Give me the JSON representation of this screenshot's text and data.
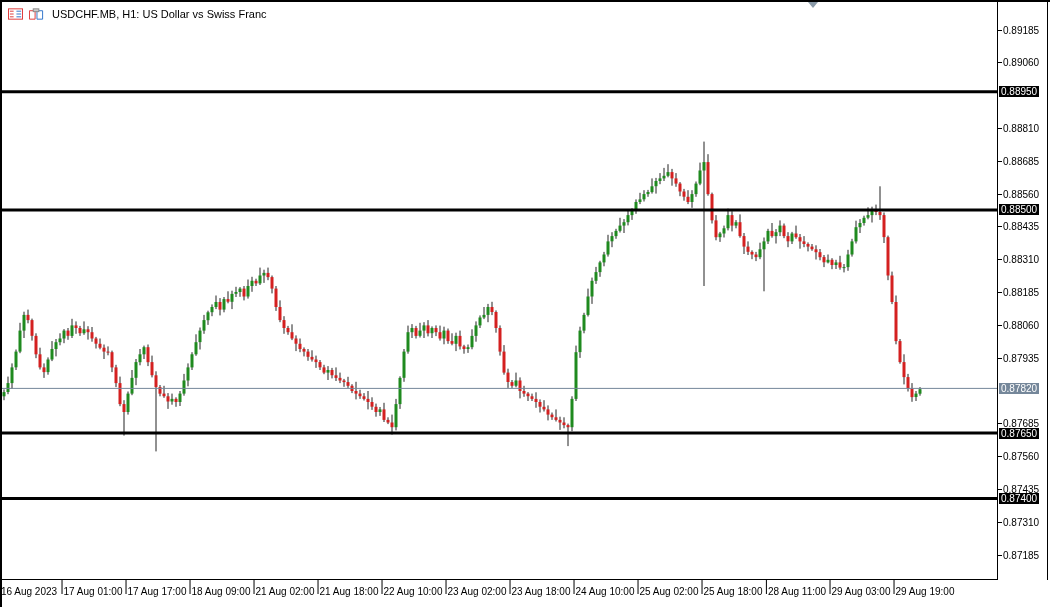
{
  "window": {
    "title": "USDCHF.MB, H1:  US Dollar vs Swiss Franc"
  },
  "chart": {
    "chart_data": {
      "type": "candlestick",
      "ylim": [
        0.8709,
        0.89292
      ],
      "ref_lines": [
        {
          "axis": "y",
          "value": 0.8895,
          "label": "0.88950",
          "color": "#000000"
        },
        {
          "axis": "y",
          "value": 0.885,
          "label": "0.88500",
          "color": "#000000"
        },
        {
          "axis": "y",
          "value": 0.8782,
          "label": "0.87820",
          "color": "#75879a"
        },
        {
          "axis": "y",
          "value": 0.8765,
          "label": "0.87650",
          "color": "#000000"
        },
        {
          "axis": "y",
          "value": 0.874,
          "label": "0.87400",
          "color": "#000000"
        }
      ],
      "categories": [
        null,
        null,
        null,
        null,
        null,
        null,
        "16 Aug 2023",
        null,
        null,
        null,
        null,
        null,
        null,
        null,
        null,
        null,
        null,
        null,
        null,
        null,
        null,
        null,
        "17 Aug 01:00",
        null,
        null,
        null,
        null,
        null,
        null,
        null,
        null,
        null,
        null,
        null,
        null,
        null,
        null,
        null,
        "17 Aug 17:00",
        null,
        null,
        null,
        null,
        null,
        null,
        null,
        null,
        null,
        null,
        null,
        null,
        null,
        null,
        null,
        "18 Aug 09:00",
        null,
        null,
        null,
        null,
        null,
        null,
        null,
        null,
        null,
        null,
        null,
        null,
        null,
        null,
        null,
        "21 Aug 02:00",
        null,
        null,
        null,
        null,
        null,
        null,
        null,
        null,
        null,
        null,
        null,
        null,
        null,
        null,
        null,
        "21 Aug 18:00",
        null,
        null,
        null,
        null,
        null,
        null,
        null,
        null,
        null,
        null,
        null,
        null,
        null,
        null,
        null,
        "22 Aug 10:00",
        null,
        null,
        null,
        null,
        null,
        null,
        null,
        null,
        null,
        null,
        null,
        null,
        null,
        null,
        null,
        "23 Aug 02:00",
        null,
        null,
        null,
        null,
        null,
        null,
        null,
        null,
        null,
        null,
        null,
        null,
        null,
        null,
        null,
        "23 Aug 18:00",
        null,
        null,
        null,
        null,
        null,
        null,
        null,
        null,
        null,
        null,
        null,
        null,
        null,
        null,
        null,
        "24 Aug 10:00",
        null,
        null,
        null,
        null,
        null,
        null,
        null,
        null,
        null,
        null,
        null,
        null,
        null,
        null,
        null,
        "25 Aug 02:00",
        null,
        null,
        null,
        null,
        null,
        null,
        null,
        null,
        null,
        null,
        null,
        null,
        null,
        null,
        null,
        "25 Aug 18:00",
        null,
        null,
        null,
        null,
        null,
        null,
        null,
        null,
        null,
        null,
        null,
        null,
        null,
        null,
        null,
        "28 Aug 11:00",
        null,
        null,
        null,
        null,
        null,
        null,
        null,
        null,
        null,
        null,
        null,
        null,
        null,
        null,
        null,
        "29 Aug 03:00",
        null,
        null,
        null,
        null,
        null,
        null,
        null,
        null,
        null,
        null,
        null,
        null,
        null,
        null,
        null,
        "29 Aug 19:00",
        null,
        null,
        null,
        null,
        null,
        null,
        null,
        null,
        null,
        null,
        null,
        null,
        null,
        null,
        null,
        null,
        null,
        null
      ],
      "ohlc": [
        [
          0.8779,
          0.87816,
          0.87775,
          0.87806
        ],
        [
          0.87806,
          0.87865,
          0.87798,
          0.8784
        ],
        [
          0.8784,
          0.87915,
          0.87818,
          0.879
        ],
        [
          0.879,
          0.87968,
          0.8789,
          0.8796
        ],
        [
          0.8796,
          0.8807,
          0.87954,
          0.8804
        ],
        [
          0.8804,
          0.88112,
          0.88012,
          0.881
        ],
        [
          0.881,
          0.8812,
          0.88068,
          0.8808
        ],
        [
          0.8808,
          0.88086,
          0.88002,
          0.8802
        ],
        [
          0.8802,
          0.8803,
          0.87935,
          0.8795
        ],
        [
          0.8795,
          0.87975,
          0.87892,
          0.879
        ],
        [
          0.879,
          0.87915,
          0.8786,
          0.87882
        ],
        [
          0.87882,
          0.87938,
          0.87872,
          0.8793
        ],
        [
          0.8793,
          0.88,
          0.87924,
          0.8797
        ],
        [
          0.8797,
          0.88008,
          0.87942,
          0.87996
        ],
        [
          0.87996,
          0.8803,
          0.87984,
          0.8801
        ],
        [
          0.8801,
          0.88046,
          0.87992,
          0.8804
        ],
        [
          0.8804,
          0.8805,
          0.88005,
          0.8802
        ],
        [
          0.8802,
          0.88085,
          0.88012,
          0.8806
        ],
        [
          0.8806,
          0.88075,
          0.88028,
          0.8805
        ],
        [
          0.8805,
          0.88058,
          0.8802,
          0.8803
        ],
        [
          0.8803,
          0.88075,
          0.88024,
          0.88045
        ],
        [
          0.88045,
          0.88057,
          0.88006,
          0.88034
        ],
        [
          0.88034,
          0.88054,
          0.87998,
          0.8801
        ],
        [
          0.8801,
          0.88016,
          0.87972,
          0.8799
        ],
        [
          0.8799,
          0.8801,
          0.87969,
          0.87975
        ],
        [
          0.87975,
          0.87987,
          0.87932,
          0.8796
        ],
        [
          0.8796,
          0.8798,
          0.87946,
          0.87958
        ],
        [
          0.87958,
          0.87964,
          0.87882,
          0.879
        ],
        [
          0.879,
          0.8791,
          0.87825,
          0.8784
        ],
        [
          0.8784,
          0.87865,
          0.87752,
          0.8776
        ],
        [
          0.8776,
          0.87775,
          0.8764,
          0.8773
        ],
        [
          0.8773,
          0.87808,
          0.8772,
          0.878
        ],
        [
          0.878,
          0.8789,
          0.87794,
          0.8786
        ],
        [
          0.8786,
          0.87932,
          0.87832,
          0.8792
        ],
        [
          0.8792,
          0.8797,
          0.87908,
          0.8795
        ],
        [
          0.8795,
          0.87983,
          0.87932,
          0.87977
        ],
        [
          0.87977,
          0.87987,
          0.87905,
          0.8792
        ],
        [
          0.8792,
          0.87945,
          0.87862,
          0.8787
        ],
        [
          0.8787,
          0.87885,
          0.8758,
          0.87825
        ],
        [
          0.87825,
          0.87833,
          0.8779,
          0.878
        ],
        [
          0.878,
          0.8783,
          0.87784,
          0.8779
        ],
        [
          0.8779,
          0.87802,
          0.87742,
          0.8777
        ],
        [
          0.8777,
          0.878,
          0.87758,
          0.8778
        ],
        [
          0.8778,
          0.87786,
          0.8775,
          0.87768
        ],
        [
          0.87768,
          0.8781,
          0.87753,
          0.878
        ],
        [
          0.878,
          0.87875,
          0.87792,
          0.8785
        ],
        [
          0.8785,
          0.87915,
          0.87828,
          0.879
        ],
        [
          0.879,
          0.87958,
          0.8789,
          0.8795
        ],
        [
          0.8795,
          0.88026,
          0.87944,
          0.87996
        ],
        [
          0.87996,
          0.88052,
          0.87968,
          0.8804
        ],
        [
          0.8804,
          0.881,
          0.88028,
          0.8808
        ],
        [
          0.8808,
          0.88116,
          0.88062,
          0.8811
        ],
        [
          0.8811,
          0.8814,
          0.88095,
          0.8813
        ],
        [
          0.8813,
          0.88174,
          0.88122,
          0.88149
        ],
        [
          0.88149,
          0.88164,
          0.88098,
          0.8812
        ],
        [
          0.8812,
          0.88168,
          0.8811,
          0.8816
        ],
        [
          0.8816,
          0.8819,
          0.88144,
          0.8815
        ],
        [
          0.8815,
          0.88192,
          0.88122,
          0.8818
        ],
        [
          0.8818,
          0.88207,
          0.88168,
          0.88187
        ],
        [
          0.88187,
          0.88206,
          0.88169,
          0.882
        ],
        [
          0.882,
          0.8821,
          0.88155,
          0.8817
        ],
        [
          0.8817,
          0.88235,
          0.88162,
          0.8821
        ],
        [
          0.8821,
          0.88245,
          0.88188,
          0.8823
        ],
        [
          0.8823,
          0.88238,
          0.8821,
          0.8822
        ],
        [
          0.8822,
          0.8828,
          0.88214,
          0.8825
        ],
        [
          0.8825,
          0.88272,
          0.88222,
          0.8826
        ],
        [
          0.8826,
          0.8828,
          0.88232,
          0.88244
        ],
        [
          0.88244,
          0.8825,
          0.88182,
          0.882
        ],
        [
          0.882,
          0.8821,
          0.88115,
          0.8813
        ],
        [
          0.8813,
          0.88155,
          0.88072,
          0.8808
        ],
        [
          0.8808,
          0.88095,
          0.88028,
          0.8805
        ],
        [
          0.8805,
          0.88058,
          0.88024,
          0.88034
        ],
        [
          0.88034,
          0.88064,
          0.88004,
          0.8801
        ],
        [
          0.8801,
          0.88022,
          0.87962,
          0.8799
        ],
        [
          0.8799,
          0.8801,
          0.87958,
          0.8797
        ],
        [
          0.8797,
          0.87976,
          0.87942,
          0.8796
        ],
        [
          0.8796,
          0.8797,
          0.87925,
          0.8794
        ],
        [
          0.8794,
          0.87965,
          0.87922,
          0.8793
        ],
        [
          0.8793,
          0.87945,
          0.87898,
          0.8792
        ],
        [
          0.8792,
          0.87928,
          0.8789,
          0.879
        ],
        [
          0.879,
          0.8791,
          0.87874,
          0.8788
        ],
        [
          0.8788,
          0.87905,
          0.87852,
          0.8789
        ],
        [
          0.8789,
          0.87898,
          0.87858,
          0.8787
        ],
        [
          0.8787,
          0.879,
          0.87848,
          0.8786
        ],
        [
          0.8786,
          0.8788,
          0.8784,
          0.8785
        ],
        [
          0.8785,
          0.87856,
          0.87826,
          0.87844
        ],
        [
          0.87844,
          0.87864,
          0.87822,
          0.8783
        ],
        [
          0.8783,
          0.87836,
          0.87802,
          0.8781
        ],
        [
          0.8781,
          0.87845,
          0.87778,
          0.878
        ],
        [
          0.878,
          0.87815,
          0.8778,
          0.8779
        ],
        [
          0.8779,
          0.87802,
          0.87774,
          0.8778
        ],
        [
          0.8778,
          0.8781,
          0.8774,
          0.87768
        ],
        [
          0.87768,
          0.87786,
          0.87738,
          0.8775
        ],
        [
          0.8775,
          0.87762,
          0.87712,
          0.8773
        ],
        [
          0.8773,
          0.87749,
          0.87715,
          0.8774
        ],
        [
          0.8774,
          0.87765,
          0.87692,
          0.877
        ],
        [
          0.877,
          0.8771,
          0.87684,
          0.8769
        ],
        [
          0.8769,
          0.8772,
          0.87644,
          0.87672
        ],
        [
          0.87672,
          0.8778,
          0.8766,
          0.8776
        ],
        [
          0.8776,
          0.87866,
          0.87742,
          0.8786
        ],
        [
          0.8786,
          0.8797,
          0.87845,
          0.8796
        ],
        [
          0.8796,
          0.88059,
          0.87952,
          0.88034
        ],
        [
          0.88034,
          0.88065,
          0.88012,
          0.8805
        ],
        [
          0.8805,
          0.88058,
          0.8801,
          0.8802
        ],
        [
          0.8802,
          0.8807,
          0.88014,
          0.8804
        ],
        [
          0.8804,
          0.88072,
          0.88012,
          0.8806
        ],
        [
          0.8806,
          0.8808,
          0.88018,
          0.8803
        ],
        [
          0.8803,
          0.88056,
          0.88012,
          0.8805
        ],
        [
          0.8805,
          0.8806,
          0.88019,
          0.88034
        ],
        [
          0.88034,
          0.88059,
          0.88002,
          0.8801
        ],
        [
          0.8801,
          0.88055,
          0.87988,
          0.8804
        ],
        [
          0.8804,
          0.88048,
          0.8799,
          0.88
        ],
        [
          0.88,
          0.8803,
          0.87984,
          0.8799
        ],
        [
          0.8799,
          0.88032,
          0.87962,
          0.8802
        ],
        [
          0.8802,
          0.8804,
          0.87968,
          0.8798
        ],
        [
          0.8798,
          0.87986,
          0.87952,
          0.8797
        ],
        [
          0.8797,
          0.87987,
          0.87955,
          0.87977
        ],
        [
          0.87977,
          0.88045,
          0.87969,
          0.8802
        ],
        [
          0.8802,
          0.88075,
          0.87998,
          0.8806
        ],
        [
          0.8806,
          0.88098,
          0.8805,
          0.8809
        ],
        [
          0.8809,
          0.8813,
          0.88084,
          0.881
        ],
        [
          0.881,
          0.88142,
          0.88072,
          0.8813
        ],
        [
          0.8813,
          0.8815,
          0.88099,
          0.88111
        ],
        [
          0.88111,
          0.88117,
          0.88032,
          0.8805
        ],
        [
          0.8805,
          0.8806,
          0.87945,
          0.8796
        ],
        [
          0.8796,
          0.87985,
          0.87872,
          0.8788
        ],
        [
          0.8788,
          0.87895,
          0.87822,
          0.87844
        ],
        [
          0.87844,
          0.87852,
          0.87822,
          0.8783
        ],
        [
          0.8783,
          0.8788,
          0.87824,
          0.8785
        ],
        [
          0.8785,
          0.87862,
          0.87782,
          0.8781
        ],
        [
          0.8781,
          0.8783,
          0.87788,
          0.878
        ],
        [
          0.878,
          0.87806,
          0.87772,
          0.8779
        ],
        [
          0.8779,
          0.878,
          0.87772,
          0.8778
        ],
        [
          0.8778,
          0.87805,
          0.87746,
          0.87768
        ],
        [
          0.87768,
          0.87778,
          0.87728,
          0.8775
        ],
        [
          0.8775,
          0.87775,
          0.87732,
          0.8774
        ],
        [
          0.8774,
          0.87755,
          0.87698,
          0.8772
        ],
        [
          0.8772,
          0.87728,
          0.877,
          0.8771
        ],
        [
          0.8771,
          0.8774,
          0.87694,
          0.877
        ],
        [
          0.877,
          0.87712,
          0.87662,
          0.8769
        ],
        [
          0.8769,
          0.8771,
          0.87668,
          0.8768
        ],
        [
          0.8768,
          0.87686,
          0.876,
          0.87672
        ],
        [
          0.87672,
          0.8779,
          0.87657,
          0.8778
        ],
        [
          0.8778,
          0.87983,
          0.87772,
          0.87958
        ],
        [
          0.87958,
          0.88055,
          0.87936,
          0.8804
        ],
        [
          0.8804,
          0.88108,
          0.8803,
          0.881
        ],
        [
          0.881,
          0.882,
          0.88094,
          0.8817
        ],
        [
          0.8817,
          0.88242,
          0.88142,
          0.8823
        ],
        [
          0.8823,
          0.88283,
          0.88218,
          0.88263
        ],
        [
          0.88263,
          0.88306,
          0.88245,
          0.883
        ],
        [
          0.883,
          0.8834,
          0.88285,
          0.8833
        ],
        [
          0.8833,
          0.88405,
          0.88322,
          0.8838
        ],
        [
          0.8838,
          0.88415,
          0.88358,
          0.884
        ],
        [
          0.884,
          0.88428,
          0.8839,
          0.8842
        ],
        [
          0.8842,
          0.8847,
          0.88414,
          0.8844
        ],
        [
          0.8844,
          0.88465,
          0.88412,
          0.88453
        ],
        [
          0.88453,
          0.885,
          0.88441,
          0.8848
        ],
        [
          0.8848,
          0.88506,
          0.88462,
          0.885
        ],
        [
          0.885,
          0.8854,
          0.88485,
          0.8853
        ],
        [
          0.8853,
          0.88565,
          0.88522,
          0.8854
        ],
        [
          0.8854,
          0.88575,
          0.88532,
          0.8856
        ],
        [
          0.8856,
          0.88576,
          0.8855,
          0.88568
        ],
        [
          0.88568,
          0.8862,
          0.88562,
          0.8859
        ],
        [
          0.8859,
          0.88622,
          0.88562,
          0.8861
        ],
        [
          0.8861,
          0.8864,
          0.88598,
          0.8862
        ],
        [
          0.8862,
          0.8866,
          0.8861,
          0.8863
        ],
        [
          0.8863,
          0.88674,
          0.88624,
          0.88644
        ],
        [
          0.88644,
          0.88656,
          0.88592,
          0.8862
        ],
        [
          0.8862,
          0.8864,
          0.88588,
          0.886
        ],
        [
          0.886,
          0.88606,
          0.88552,
          0.8857
        ],
        [
          0.8857,
          0.8858,
          0.88535,
          0.8855
        ],
        [
          0.8855,
          0.88575,
          0.88522,
          0.8853
        ],
        [
          0.8853,
          0.88575,
          0.88508,
          0.8856
        ],
        [
          0.8856,
          0.88608,
          0.8855,
          0.886
        ],
        [
          0.886,
          0.8868,
          0.88594,
          0.8865
        ],
        [
          0.8865,
          0.8876,
          0.8821,
          0.88682
        ],
        [
          0.88682,
          0.88712,
          0.88554,
          0.8856
        ],
        [
          0.8856,
          0.88566,
          0.88448,
          0.8846
        ],
        [
          0.8846,
          0.8848,
          0.88384,
          0.88396
        ],
        [
          0.88396,
          0.88416,
          0.88378,
          0.8841
        ],
        [
          0.8841,
          0.8844,
          0.88395,
          0.8843
        ],
        [
          0.8843,
          0.88505,
          0.88422,
          0.8848
        ],
        [
          0.8848,
          0.88495,
          0.88418,
          0.8844
        ],
        [
          0.8844,
          0.88461,
          0.8843,
          0.88453
        ],
        [
          0.88453,
          0.88483,
          0.88394,
          0.884
        ],
        [
          0.884,
          0.88412,
          0.88332,
          0.8836
        ],
        [
          0.8836,
          0.8838,
          0.88328,
          0.8834
        ],
        [
          0.8834,
          0.88346,
          0.88312,
          0.8833
        ],
        [
          0.8833,
          0.8834,
          0.88305,
          0.8832
        ],
        [
          0.8832,
          0.88375,
          0.88312,
          0.8835
        ],
        [
          0.8835,
          0.88395,
          0.8819,
          0.8838
        ],
        [
          0.8838,
          0.88428,
          0.8837,
          0.8842
        ],
        [
          0.8842,
          0.8845,
          0.88394,
          0.884
        ],
        [
          0.884,
          0.88427,
          0.88372,
          0.88415
        ],
        [
          0.88415,
          0.8846,
          0.884,
          0.8844
        ],
        [
          0.8844,
          0.88448,
          0.88392,
          0.884
        ],
        [
          0.884,
          0.88415,
          0.88358,
          0.8838
        ],
        [
          0.8838,
          0.88416,
          0.8837,
          0.8841
        ],
        [
          0.8841,
          0.8844,
          0.8839,
          0.88396
        ],
        [
          0.88396,
          0.88408,
          0.88352,
          0.8838
        ],
        [
          0.8838,
          0.884,
          0.88358,
          0.8837
        ],
        [
          0.8837,
          0.88376,
          0.88342,
          0.8836
        ],
        [
          0.8836,
          0.8837,
          0.88344,
          0.8835
        ],
        [
          0.8835,
          0.88365,
          0.88311,
          0.88339
        ],
        [
          0.88339,
          0.88351,
          0.88308,
          0.8832
        ],
        [
          0.8832,
          0.88328,
          0.88282,
          0.883
        ],
        [
          0.883,
          0.8833,
          0.88296,
          0.8831
        ],
        [
          0.8831,
          0.88316,
          0.88274,
          0.8829
        ],
        [
          0.8829,
          0.8831,
          0.88275,
          0.883
        ],
        [
          0.883,
          0.88325,
          0.88272,
          0.8828
        ],
        [
          0.8828,
          0.88294,
          0.88262,
          0.88282
        ],
        [
          0.88282,
          0.88348,
          0.88268,
          0.8833
        ],
        [
          0.8833,
          0.8839,
          0.88322,
          0.8838
        ],
        [
          0.8838,
          0.88459,
          0.88372,
          0.88434
        ],
        [
          0.88434,
          0.88465,
          0.88412,
          0.8845
        ],
        [
          0.8845,
          0.88478,
          0.8844,
          0.8847
        ],
        [
          0.8847,
          0.8851,
          0.88464,
          0.8848
        ],
        [
          0.8848,
          0.88512,
          0.88452,
          0.885
        ],
        [
          0.885,
          0.8852,
          0.8848,
          0.88492
        ],
        [
          0.88492,
          0.8859,
          0.88462,
          0.8848
        ],
        [
          0.8848,
          0.8849,
          0.88374,
          0.88396
        ],
        [
          0.88396,
          0.88402,
          0.88232,
          0.8825
        ],
        [
          0.8825,
          0.88265,
          0.88141,
          0.88149
        ],
        [
          0.88149,
          0.88174,
          0.87988,
          0.88
        ],
        [
          0.88,
          0.88008,
          0.87914,
          0.8792
        ],
        [
          0.8792,
          0.8795,
          0.87835,
          0.87863
        ],
        [
          0.87863,
          0.87875,
          0.87808,
          0.8782
        ],
        [
          0.8782,
          0.8784,
          0.87769,
          0.87787
        ],
        [
          0.87787,
          0.8781,
          0.87772,
          0.878
        ],
        [
          0.878,
          0.87825,
          0.87792,
          0.87817
        ],
        null,
        null,
        null,
        null,
        null,
        null,
        null,
        null,
        null,
        null,
        null,
        null,
        null,
        null,
        null,
        null,
        null,
        null,
        null
      ],
      "yticks": [
        {
          "value": 0.89185,
          "label": "0.89185"
        },
        {
          "value": 0.8906,
          "label": "0.89060"
        },
        {
          "value": 0.8881,
          "label": "0.88810"
        },
        {
          "value": 0.88685,
          "label": "0.88685"
        },
        {
          "value": 0.8856,
          "label": "0.88560"
        },
        {
          "value": 0.88435,
          "label": "0.88435"
        },
        {
          "value": 0.8831,
          "label": "0.88310"
        },
        {
          "value": 0.88185,
          "label": "0.88185"
        },
        {
          "value": 0.8806,
          "label": "0.88060"
        },
        {
          "value": 0.87935,
          "label": "0.87935"
        },
        {
          "value": 0.87685,
          "label": "0.87685"
        },
        {
          "value": 0.8756,
          "label": "0.87560"
        },
        {
          "value": 0.87435,
          "label": "0.87435"
        },
        {
          "value": 0.8731,
          "label": "0.87310"
        },
        {
          "value": 0.87185,
          "label": "0.87185"
        }
      ]
    }
  }
}
